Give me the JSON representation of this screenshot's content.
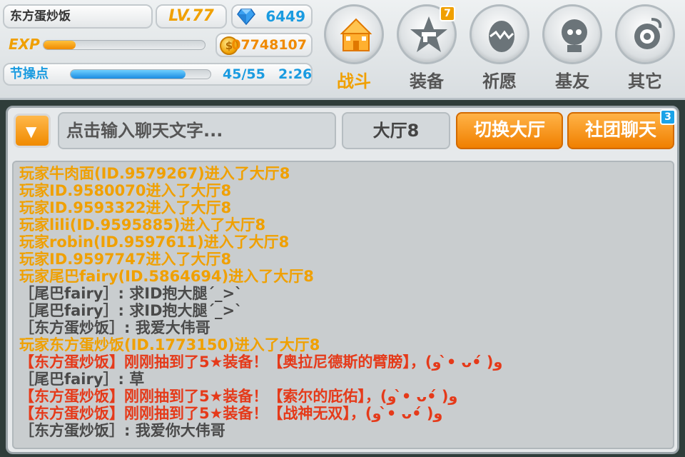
{
  "hud": {
    "player_name": "东方蛋炒饭",
    "level": "LV.77",
    "gems": "6449",
    "exp_label": "EXP",
    "exp_progress": 0.2,
    "coins": "07748107",
    "coin_symbol": "$",
    "stamina_label": "节操点",
    "stamina_value": "45/55",
    "stamina_progress": 0.82,
    "stamina_timer": "2:26"
  },
  "nav": [
    {
      "label": "战斗",
      "icon": "castle-icon",
      "active": true,
      "badge": ""
    },
    {
      "label": "装备",
      "icon": "star-gun-icon",
      "active": false,
      "badge": "7"
    },
    {
      "label": "祈愿",
      "icon": "egg-icon",
      "active": false,
      "badge": ""
    },
    {
      "label": "基友",
      "icon": "friend-icon",
      "active": false,
      "badge": ""
    },
    {
      "label": "其它",
      "icon": "settings-icon",
      "active": false,
      "badge": ""
    }
  ],
  "chat": {
    "input_placeholder": "点击输入聊天文字...",
    "hall_name": "大厅8",
    "switch_hall_label": "切换大厅",
    "club_chat_label": "社团聊天",
    "club_badge": "3",
    "dropdown_glyph": "▼",
    "messages": [
      {
        "type": "system",
        "text": "玩家牛肉面(ID.9579267)进入了大厅8"
      },
      {
        "type": "system",
        "text": "玩家ID.9580070进入了大厅8"
      },
      {
        "type": "system",
        "text": "玩家ID.9593322进入了大厅8"
      },
      {
        "type": "system",
        "text": "玩家lili(ID.9595885)进入了大厅8"
      },
      {
        "type": "system",
        "text": "玩家robin(ID.9597611)进入了大厅8"
      },
      {
        "type": "system",
        "text": "玩家ID.9597747进入了大厅8"
      },
      {
        "type": "system",
        "text": "玩家尾巴fairy(ID.5864694)进入了大厅8"
      },
      {
        "type": "chat",
        "text": "［尾巴fairy］: 求ID抱大腿´_>`"
      },
      {
        "type": "chat",
        "text": "［尾巴fairy］: 求ID抱大腿´_>`"
      },
      {
        "type": "chat",
        "text": "［东方蛋炒饭］: 我爱大伟哥"
      },
      {
        "type": "system",
        "text": "玩家东方蛋炒饭(ID.1773150)进入了大厅8"
      },
      {
        "type": "gacha",
        "text": "【东方蛋炒饭】刚刚抽到了5★装备！【奥拉尼德斯的臂膀】，(و •̀ ᴗ•́ )و"
      },
      {
        "type": "chat",
        "text": "［尾巴fairy］: 草"
      },
      {
        "type": "gacha",
        "text": "【东方蛋炒饭】刚刚抽到了5★装备！【索尔的庇佑】，(و •̀ ᴗ•́ )و"
      },
      {
        "type": "gacha",
        "text": "【东方蛋炒饭】刚刚抽到了5★装备！【战神无双】，(و •̀ ᴗ•́ )و"
      },
      {
        "type": "chat",
        "text": "［东方蛋炒饭］: 我爱你大伟哥"
      }
    ]
  },
  "colors": {
    "accent_orange": "#f0a000",
    "accent_blue": "#1a9be0",
    "gacha_red": "#e53a1a"
  }
}
